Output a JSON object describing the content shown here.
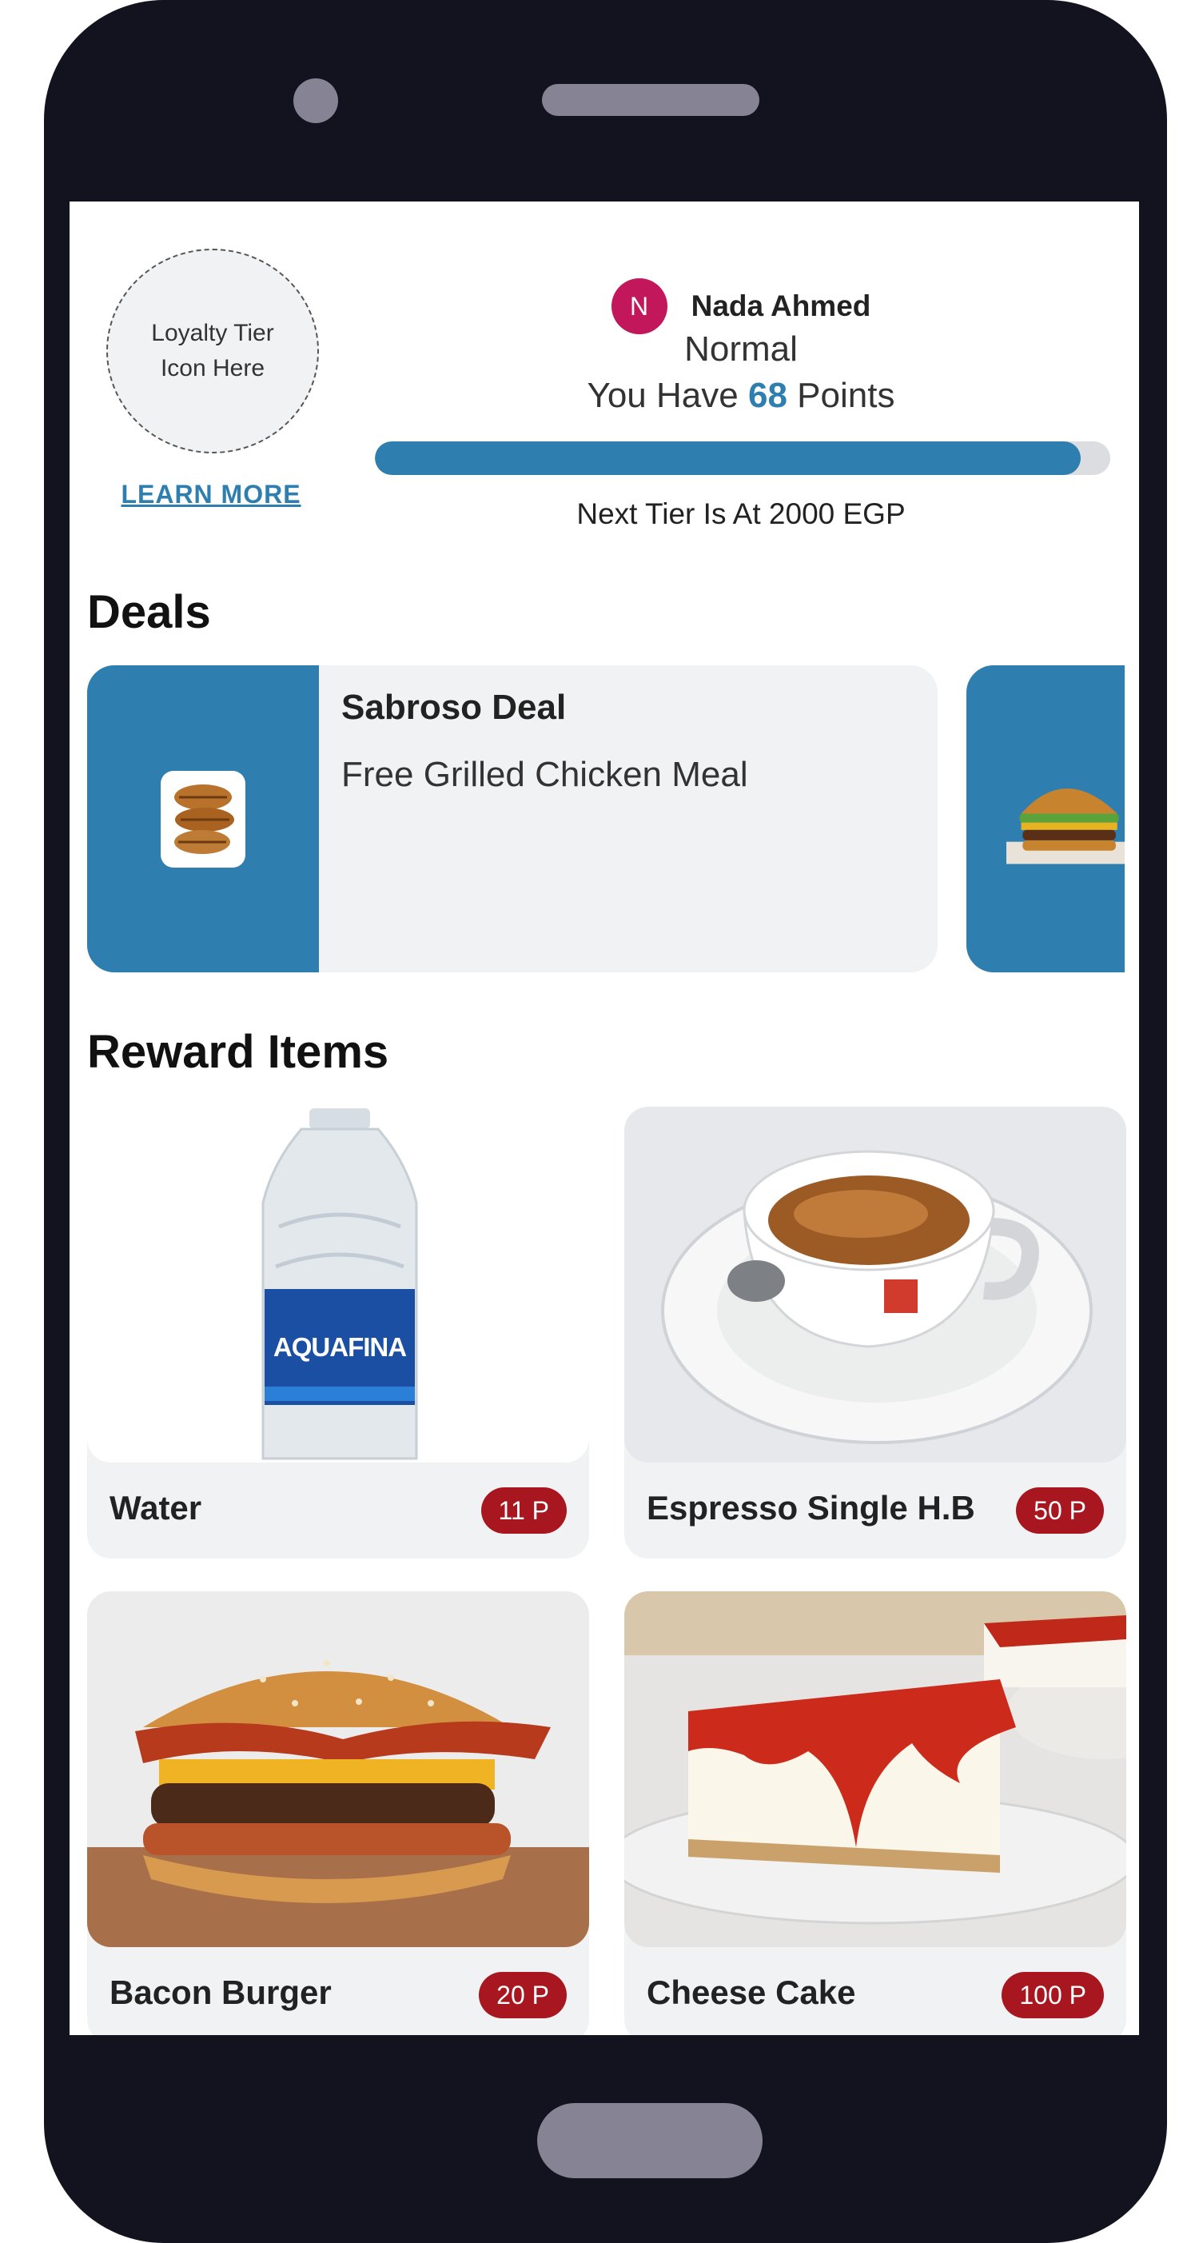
{
  "loyalty": {
    "tier_icon_placeholder": "Loyalty Tier\nIcon Here",
    "learn_more": "LEARN MORE"
  },
  "user": {
    "avatar_initial": "N",
    "name": "Nada Ahmed",
    "tier": "Normal",
    "points_prefix": "You Have",
    "points": "68",
    "points_suffix": "Points",
    "progress_fraction": 0.96,
    "next_tier": "Next Tier Is At 2000 EGP"
  },
  "deals": {
    "title": "Deals",
    "items": [
      {
        "title": "Sabroso Deal",
        "description": "Free Grilled Chicken Meal",
        "image": "grilled-chicken-image"
      },
      {
        "title": "",
        "description": "",
        "image": "burger-image"
      }
    ]
  },
  "rewards": {
    "title": "Reward Items",
    "items": [
      {
        "name": "Water",
        "price": "11 P",
        "image": "water-bottle-image",
        "bottle_label": "AQUAFINA"
      },
      {
        "name": "Espresso Single H.B",
        "price": "50 P",
        "image": "espresso-cup-image"
      },
      {
        "name": "Bacon Burger",
        "price": "20 P",
        "image": "bacon-burger-image"
      },
      {
        "name": "Cheese Cake",
        "price": "100 P",
        "image": "cheesecake-image"
      }
    ]
  },
  "colors": {
    "accent": "#2e7fb0",
    "price_badge": "#a8161f",
    "avatar": "#c2185b",
    "phone_frame": "#13121f"
  }
}
